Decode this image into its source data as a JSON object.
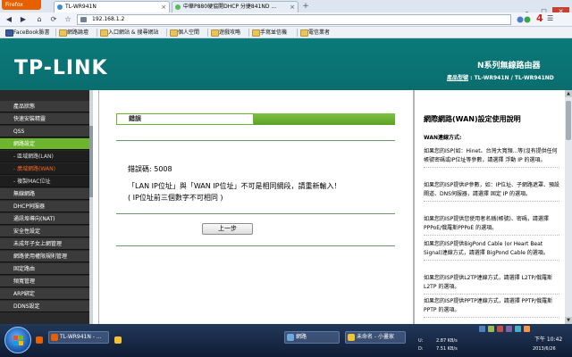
{
  "browser": {
    "app_button": "Firefox",
    "tabs": [
      {
        "label": "TL-WR941N",
        "active": true
      },
      {
        "label": "中華P880硬協開DHCP 分捷841ND ...",
        "active": false
      }
    ],
    "new_tab": "+",
    "url": "192.168.1.2",
    "notification_count": "4",
    "window_buttons": {
      "minimize": "–",
      "maximize": "□",
      "close": "✕"
    },
    "nav": {
      "back": "◀",
      "forward": "▶",
      "home": "⌂",
      "reload": "⟳"
    }
  },
  "bookmarks": [
    {
      "label": "FaceBook臉書",
      "kind": "fb"
    },
    {
      "label": "網路論壇",
      "kind": "folder"
    },
    {
      "label": "入口網站 & 搜尋網站",
      "kind": "folder"
    },
    {
      "label": "個人空間",
      "kind": "folder"
    },
    {
      "label": "遊戲攻略",
      "kind": "folder"
    },
    {
      "label": "手寫並信機",
      "kind": "folder"
    },
    {
      "label": "電信業者",
      "kind": "folder"
    }
  ],
  "router": {
    "logo": "TP-LINK",
    "series_title": "N系列無線路由器",
    "model_label": "產品型號",
    "model_value": "TL-WR941N / TL-WR941ND"
  },
  "menu": [
    {
      "label": "產品狀態",
      "type": "item"
    },
    {
      "label": "快速安裝精靈",
      "type": "item"
    },
    {
      "label": "QSS",
      "type": "item"
    },
    {
      "label": "網路設定",
      "type": "active"
    },
    {
      "label": "- 區域網路(LAN)",
      "type": "sub"
    },
    {
      "label": "- 廣域網路(WAN)",
      "type": "sub-active"
    },
    {
      "label": "- 複製MAC位址",
      "type": "sub"
    },
    {
      "label": "無線網路",
      "type": "item"
    },
    {
      "label": "DHCP伺服器",
      "type": "item"
    },
    {
      "label": "通訊埠導向(NAT)",
      "type": "item"
    },
    {
      "label": "安全性設定",
      "type": "item"
    },
    {
      "label": "未成年子女上網管理",
      "type": "item"
    },
    {
      "label": "網路使用權限規則管理",
      "type": "item"
    },
    {
      "label": "固定路由",
      "type": "item"
    },
    {
      "label": "頻寬管理",
      "type": "item"
    },
    {
      "label": "ARP綁定",
      "type": "item"
    },
    {
      "label": "DDNS設定",
      "type": "item"
    }
  ],
  "main": {
    "section_title": "錯誤",
    "error_code": "錯誤碼: 5008",
    "error_message": "「LAN IP位址」與「WAN IP位址」不可是相同網段，請重新輸入！",
    "error_hint": "( IP位址前三個數字不可相同 )",
    "back_button": "上一步"
  },
  "help": {
    "title": "網際網路(WAN)設定使用說明",
    "subtitle": "WAN連線方式:",
    "paragraphs": [
      {
        "text": "如果您的ISP(如：Hinet、台灣大寬頻...等)沒有提供任何帳號密碼或IP位址等參數，請選擇 浮動 IP 的選項。",
        "bold": ""
      },
      {
        "text": "如果您的ISP提供IP參數，如：IP位址、子網路遮罩、預設閘道、DNS伺服器，請選擇 固定 IP 的選項。",
        "bold": ""
      },
      {
        "text": "如果您的ISP提供您使用者名稱(帳號)、密碼，請選擇 PPPoE/俄羅斯PPPoE 的選項。",
        "bold": ""
      },
      {
        "text": "如果您的ISP提供BigPond Cable (or Heart Beat Signal)連線方式，請選擇 BigPond Cable 的選項。",
        "bold": ""
      },
      {
        "text": "如果您的ISP提供L2TP連線方式，請選擇 L2TP/俄羅斯L2TP 的選項。",
        "bold": ""
      },
      {
        "text": "如果您的ISP提供PPTP連線方式，請選擇 PPTP/俄羅斯PPTP 的選項。",
        "bold": ""
      }
    ]
  },
  "taskbar": {
    "windows": [
      {
        "label": "TL-WR941N - ...",
        "color": "#e66000"
      },
      {
        "label": "網路",
        "color": "#6fa8dc"
      },
      {
        "label": "未命名 - 小畫家",
        "color": "#f1c232"
      }
    ],
    "tray": {
      "u_label": "U:",
      "u_value": "2.87 KB/s",
      "d_label": "D:",
      "d_value": "7.51 KB/s",
      "time": "下午 10:42",
      "date": "2013/6/26"
    }
  },
  "colors": {
    "router_teal": "#0a7373",
    "menu_green": "#6cb52d",
    "menu_sub_active": "#f26522",
    "taskbar": "#17274a"
  }
}
